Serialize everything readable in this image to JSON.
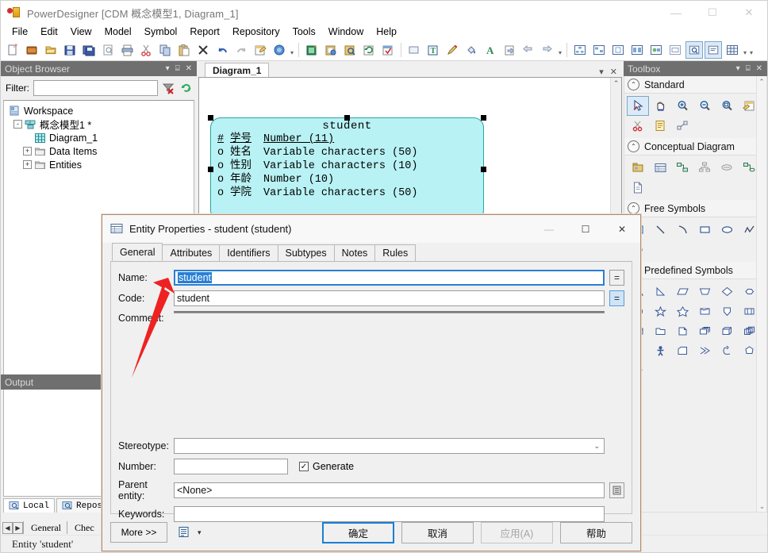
{
  "window": {
    "title": "PowerDesigner [CDM 概念模型1, Diagram_1]",
    "app_icon": "powerdesigner-icon",
    "minimize": "—",
    "maximize": "☐",
    "close": "✕"
  },
  "menubar": {
    "items": [
      {
        "label": "File"
      },
      {
        "label": "Edit"
      },
      {
        "label": "View"
      },
      {
        "label": "Model"
      },
      {
        "label": "Symbol"
      },
      {
        "label": "Report"
      },
      {
        "label": "Repository"
      },
      {
        "label": "Tools"
      },
      {
        "label": "Window"
      },
      {
        "label": "Help"
      }
    ]
  },
  "toolbar": {
    "groups": [
      {
        "icons": [
          "new-document-icon",
          "open-workspace-icon",
          "open-folder-icon",
          "save-icon",
          "save-all-icon",
          "print-preview-icon",
          "print-icon",
          "cut-icon",
          "copy-icon",
          "paste-icon",
          "delete-icon",
          "undo-icon",
          "redo-icon",
          "properties-icon",
          "help-icon"
        ]
      },
      {
        "icons": [
          "new-model-icon",
          "generate-model-icon",
          "find-objects-icon",
          "refresh-icon",
          "check-model-icon"
        ]
      },
      {
        "icons": [
          "shape-icon",
          "text-format-icon",
          "pencil-icon",
          "fill-color-icon",
          "font-color-icon",
          "export-icon",
          "previous-icon",
          "next-icon"
        ]
      },
      {
        "icons": [
          "layout-tree-icon",
          "layout-auto-icon",
          "page-layout-icon",
          "align-icon",
          "symbol-format-icon",
          "display-preferences-icon",
          "zoom-region-icon",
          "comment-icon",
          "grid-icon"
        ]
      }
    ]
  },
  "browser": {
    "title": "Object Browser",
    "dropdown_icon": "chevron-down-icon",
    "pin_icon": "pin-icon",
    "close_icon": "close-icon",
    "filter_label": "Filter:",
    "filter_value": "",
    "filter_clear_icon": "filter-clear-icon",
    "filter_refresh_icon": "refresh-icon",
    "tree": [
      {
        "label": "Workspace",
        "icon": "workspace-icon",
        "depth": 0,
        "expander": ""
      },
      {
        "label": "概念模型1 *",
        "icon": "model-icon",
        "depth": 1,
        "expander": "-"
      },
      {
        "label": "Diagram_1",
        "icon": "diagram-icon",
        "depth": 2,
        "expander": ""
      },
      {
        "label": "Data Items",
        "icon": "folder-icon",
        "depth": 2,
        "expander": "+"
      },
      {
        "label": "Entities",
        "icon": "folder-icon",
        "depth": 2,
        "expander": "+"
      }
    ],
    "tabs": [
      {
        "label": "Local",
        "icon": "local-icon",
        "active": true
      },
      {
        "label": "Reposi",
        "icon": "repository-icon",
        "active": false
      }
    ]
  },
  "diagram": {
    "tab_label": "Diagram_1",
    "tab_dropdown_icon": "chevron-down-icon",
    "tab_close_icon": "close-icon",
    "scroll_up_icon": "chevron-up-icon",
    "scroll_down_icon": "chevron-down-icon",
    "entity": {
      "name": "student",
      "fill_color": "#b9f2f4",
      "border_color": "#24a5a8",
      "attributes": [
        {
          "mark": "#",
          "name": "学号",
          "type": "Number (11)",
          "primary": true
        },
        {
          "mark": "o",
          "name": "姓名",
          "type": "Variable characters (50)",
          "primary": false
        },
        {
          "mark": "o",
          "name": "性别",
          "type": "Variable characters (10)",
          "primary": false
        },
        {
          "mark": "o",
          "name": "年龄",
          "type": "Number (10)",
          "primary": false
        },
        {
          "mark": "o",
          "name": "学院",
          "type": "Variable characters (50)",
          "primary": false
        }
      ]
    }
  },
  "toolbox": {
    "title": "Toolbox",
    "dropdown_icon": "chevron-down-icon",
    "pin_icon": "pin-icon",
    "close_icon": "close-icon",
    "sections": [
      {
        "title": "Standard",
        "collapse_icon": "chevron-up-circle-icon",
        "items": [
          {
            "icon": "pointer-icon",
            "selected": true
          },
          {
            "icon": "grabber-hand-icon",
            "selected": false
          },
          {
            "icon": "zoom-in-icon",
            "selected": false
          },
          {
            "icon": "zoom-out-icon",
            "selected": false
          },
          {
            "icon": "zoom-area-icon",
            "selected": false
          },
          {
            "icon": "open-diagram-icon",
            "selected": false
          },
          {
            "icon": "delete-scissors-icon",
            "selected": false
          },
          {
            "icon": "note-icon",
            "selected": false
          },
          {
            "icon": "link-note-icon",
            "selected": false
          }
        ]
      },
      {
        "title": "Conceptual Diagram",
        "collapse_icon": "chevron-up-circle-icon",
        "items": [
          {
            "icon": "package-icon",
            "selected": false
          },
          {
            "icon": "entity-icon",
            "selected": false
          },
          {
            "icon": "relationship-icon",
            "selected": false
          },
          {
            "icon": "inheritance-icon",
            "selected": false
          },
          {
            "icon": "association-icon",
            "selected": false
          },
          {
            "icon": "association-link-icon",
            "selected": false
          },
          {
            "icon": "file-object-icon",
            "selected": false
          }
        ]
      },
      {
        "title": "Free Symbols",
        "collapse_icon": "chevron-up-circle-icon",
        "items": [
          {
            "icon": "text-symbol-icon",
            "selected": false
          },
          {
            "icon": "line-icon",
            "selected": false
          },
          {
            "icon": "arc-icon",
            "selected": false
          },
          {
            "icon": "rectangle-icon",
            "selected": false
          },
          {
            "icon": "ellipse-icon",
            "selected": false
          },
          {
            "icon": "polyline-icon",
            "selected": false
          },
          {
            "icon": "polygon-icon",
            "selected": false
          }
        ]
      },
      {
        "title": "Predefined Symbols",
        "collapse_icon": "chevron-up-circle-icon",
        "items": [
          {
            "icon": "triangle-icon",
            "selected": false
          },
          {
            "icon": "right-triangle-icon",
            "selected": false
          },
          {
            "icon": "parallelogram-icon",
            "selected": false
          },
          {
            "icon": "trapezoid-icon",
            "selected": false
          },
          {
            "icon": "diamond-icon",
            "selected": false
          },
          {
            "icon": "hexagon-flat-icon",
            "selected": false
          },
          {
            "icon": "circle-icon",
            "selected": false
          },
          {
            "icon": "star-5-icon",
            "selected": false
          },
          {
            "icon": "star-6-icon",
            "selected": false
          },
          {
            "icon": "page-corner-icon",
            "selected": false
          },
          {
            "icon": "shield-icon",
            "selected": false
          },
          {
            "icon": "split-box-icon",
            "selected": false
          },
          {
            "icon": "table-box-icon",
            "selected": false
          },
          {
            "icon": "folder-shape-icon",
            "selected": false
          },
          {
            "icon": "document-shape-icon",
            "selected": false
          },
          {
            "icon": "stacked-pages-icon",
            "selected": false
          },
          {
            "icon": "cube-icon",
            "selected": false
          },
          {
            "icon": "stacked-cube-icon",
            "selected": false
          },
          {
            "icon": "cylinder-icon",
            "selected": false
          },
          {
            "icon": "actor-icon",
            "selected": false
          },
          {
            "icon": "note-corner-icon",
            "selected": false
          },
          {
            "icon": "double-arrow-icon",
            "selected": false
          },
          {
            "icon": "arrow-curve-icon",
            "selected": false
          },
          {
            "icon": "heptagon-icon",
            "selected": false
          },
          {
            "icon": "pentagon-arrow-icon",
            "selected": false
          }
        ]
      }
    ],
    "scroll_up_icon": "chevron-up-icon",
    "scroll_down_icon": "chevron-down-icon"
  },
  "output": {
    "title": "Output",
    "dropdown_icon": "chevron-down-icon",
    "pin_icon": "pin-icon",
    "close_icon": "close-icon",
    "content": ""
  },
  "sheet_tabs": {
    "prev_icon": "◀",
    "next_icon": "▶",
    "tabs": [
      {
        "label": "General",
        "active": true
      },
      {
        "label": "Chec",
        "active": false
      }
    ]
  },
  "statusbar": {
    "text": "Entity 'student'"
  },
  "dialog": {
    "icon": "entity-properties-icon",
    "title": "Entity Properties - student (student)",
    "minimize": "—",
    "maximize": "☐",
    "close": "✕",
    "tabs": [
      {
        "label": "General",
        "active": true
      },
      {
        "label": "Attributes",
        "active": false
      },
      {
        "label": "Identifiers",
        "active": false
      },
      {
        "label": "Subtypes",
        "active": false
      },
      {
        "label": "Notes",
        "active": false
      },
      {
        "label": "Rules",
        "active": false
      }
    ],
    "fields": {
      "name_label": "Name:",
      "name_value": "student",
      "name_selected": true,
      "name_equals_btn": "=",
      "code_label": "Code:",
      "code_value": "student",
      "code_equals_btn": "=",
      "comment_label": "Comment:",
      "comment_value": "",
      "stereotype_label": "Stereotype:",
      "stereotype_value": "",
      "stereotype_dropdown_icon": "chevron-down-icon",
      "number_label": "Number:",
      "number_value": "",
      "generate_label": "Generate",
      "generate_checked": true,
      "generate_check_glyph": "✓",
      "parent_entity_label": "Parent entity:",
      "parent_entity_value": "<None>",
      "parent_entity_btn_icon": "select-object-icon",
      "keywords_label": "Keywords:",
      "keywords_value": ""
    },
    "footer": {
      "more_label": "More >>",
      "menu_icon": "properties-list-icon",
      "menu_dropdown_icon": "chevron-down-icon",
      "ok_label": "确定",
      "cancel_label": "取消",
      "apply_label": "应用(A)",
      "apply_disabled": true,
      "help_label": "帮助"
    }
  },
  "annotation": {
    "arrow_color": "#ee2222",
    "arrow_name": "red-pointer-arrow"
  }
}
